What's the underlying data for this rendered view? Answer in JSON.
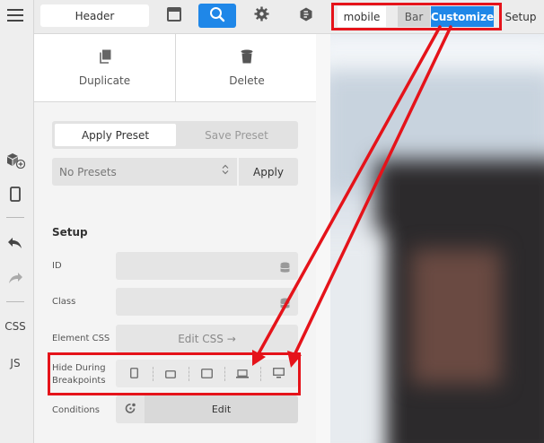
{
  "rail": {
    "items": [
      {
        "name": "menu-icon"
      },
      {
        "name": "add-element-icon"
      },
      {
        "name": "mobile-device-icon"
      },
      {
        "name": "undo-icon"
      },
      {
        "name": "redo-icon"
      }
    ],
    "css_label": "CSS",
    "js_label": "JS"
  },
  "toolbar": {
    "title": "Header",
    "buttons": [
      {
        "name": "layout-icon",
        "active": false
      },
      {
        "name": "search-icon",
        "active": true
      },
      {
        "name": "gear-icon",
        "active": false
      },
      {
        "name": "brand-icon",
        "active": false
      }
    ]
  },
  "actions": {
    "duplicate": "Duplicate",
    "delete": "Delete"
  },
  "presets": {
    "apply_tab": "Apply Preset",
    "save_tab": "Save Preset",
    "select_value": "No Presets",
    "apply_button": "Apply"
  },
  "setup": {
    "title": "Setup",
    "id_label": "ID",
    "class_label": "Class",
    "element_css_label": "Element CSS",
    "edit_css_button": "Edit CSS →",
    "hide_label_line1": "Hide During",
    "hide_label_line2": "Breakpoints",
    "breakpoints": [
      "phone-portrait-icon",
      "phone-landscape-icon",
      "tablet-icon",
      "laptop-icon",
      "desktop-icon"
    ],
    "conditions_label": "Conditions",
    "conditions_button": "Edit"
  },
  "preview_bar": {
    "device": "mobile",
    "bar_tab": "Bar",
    "customize_tab": "Customize",
    "setup_tab": "Setup"
  },
  "colors": {
    "accent": "#1f87e8",
    "annotation": "#e5131a"
  }
}
